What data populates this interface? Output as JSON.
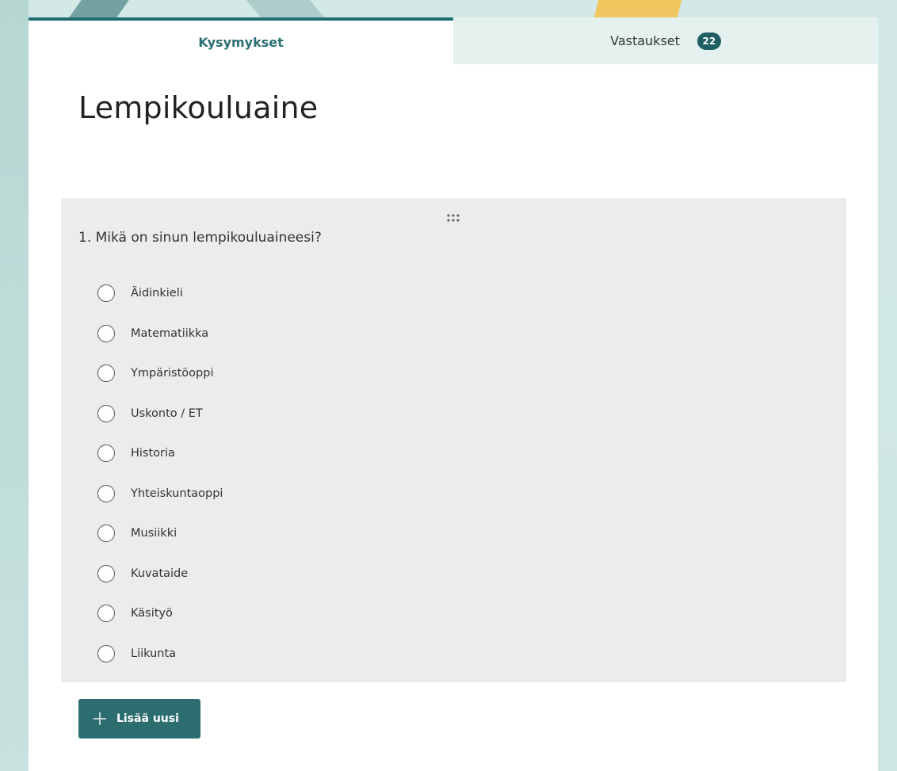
{
  "tabs": {
    "questions_label": "Kysymykset",
    "responses_label": "Vastaukset",
    "responses_count": "22"
  },
  "form": {
    "title": "Lempikouluaine"
  },
  "question": {
    "title": "1. Mikä on sinun lempikouluaineesi?",
    "options": [
      "Äidinkieli",
      "Matematiikka",
      "Ympäristöoppi",
      "Uskonto / ET",
      "Historia",
      "Yhteiskuntaoppi",
      "Musiikki",
      "Kuvataide",
      "Käsityö",
      "Liikunta"
    ]
  },
  "actions": {
    "add_new_label": "Lisää uusi"
  },
  "colors": {
    "accent": "#2c6d70",
    "badge": "#1f5f63",
    "question_bg": "#ececec"
  }
}
